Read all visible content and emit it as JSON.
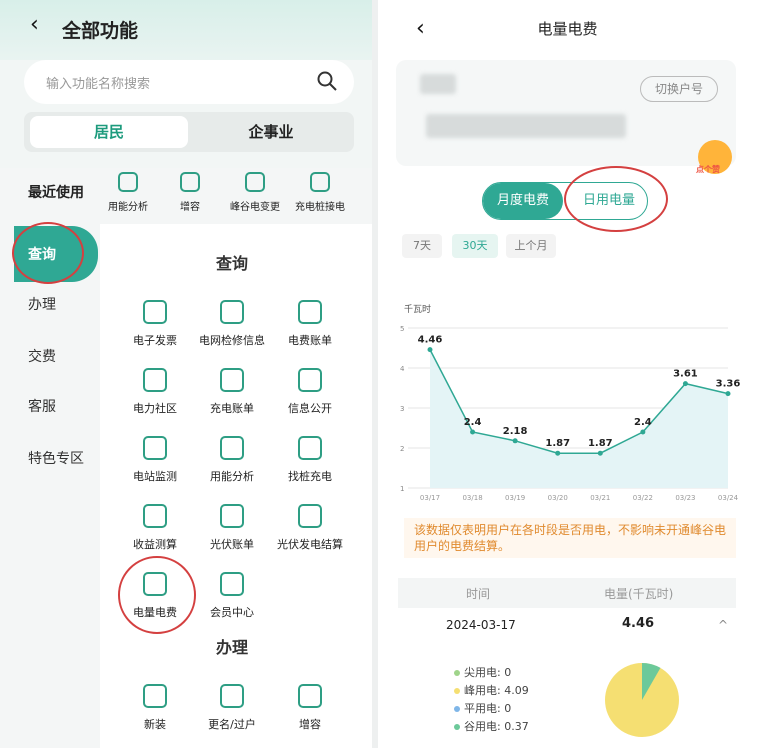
{
  "left": {
    "back_glyph": "‹",
    "title": "全部功能",
    "search_placeholder": "输入功能名称搜索",
    "segments": [
      "居民",
      "企事业"
    ],
    "recent_label": "最近使用",
    "recent_items": [
      "用能分析",
      "增容",
      "峰谷电变更",
      "充电桩接电"
    ],
    "sidebar": [
      "查询",
      "办理",
      "交费",
      "客服",
      "特色专区"
    ],
    "section_query": "查询",
    "query_items": [
      "电子发票",
      "电网检修信息",
      "电费账单",
      "电力社区",
      "充电账单",
      "信息公开",
      "电站监测",
      "用能分析",
      "找桩充电",
      "收益测算",
      "光伏账单",
      "光伏发电结算",
      "电量电费",
      "会员中心"
    ],
    "section_handle": "办理",
    "handle_items": [
      "新装",
      "更名/过户",
      "增容"
    ]
  },
  "right": {
    "back_glyph": "‹",
    "title": "电量电费",
    "switch_account": "切换户号",
    "mascot_label": "点个赞",
    "tabs": [
      "月度电费",
      "日用电量"
    ],
    "ranges": [
      "7天",
      "30天",
      "上个月"
    ],
    "note": "该数据仅表明用户在各时段是否用电，不影响未开通峰谷电用户的电费结算。",
    "table_headers": [
      "时间",
      "电量(千瓦时)"
    ],
    "row": {
      "date": "2024-03-17",
      "value": "4.46",
      "chevron": "^"
    },
    "breakdown": [
      {
        "label": "尖用电:",
        "value": "0",
        "color": "#9fd48a"
      },
      {
        "label": "峰用电:",
        "value": "4.09",
        "color": "#f5df72"
      },
      {
        "label": "平用电:",
        "value": "0",
        "color": "#7fb6e8"
      },
      {
        "label": "谷用电:",
        "value": "0.37",
        "color": "#6cc99a"
      }
    ]
  },
  "chart_data": {
    "type": "area",
    "ylabel": "千瓦时",
    "ylim": [
      1,
      5
    ],
    "yticks": [
      "5",
      "4",
      "3",
      "2",
      "1"
    ],
    "categories": [
      "03/17",
      "03/18",
      "03/19",
      "03/20",
      "03/21",
      "03/22",
      "03/23",
      "03/24"
    ],
    "values": [
      4.46,
      2.4,
      2.18,
      1.87,
      1.87,
      2.4,
      3.61,
      3.36
    ],
    "labels": [
      "4.46",
      "2.4",
      "2.18",
      "1.87",
      "1.87",
      "2.4",
      "3.61",
      "3.36"
    ],
    "line_color": "#2fa894",
    "fill_color": "#e4f4f6"
  },
  "pie_data": {
    "peak_share": 0.917,
    "valley_share": 0.083,
    "peak_color": "#f5df72",
    "valley_color": "#6cc99a"
  }
}
